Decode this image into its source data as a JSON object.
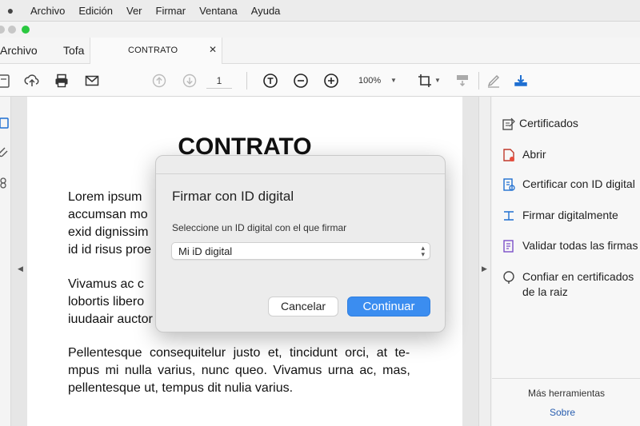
{
  "menubar": {
    "apple_icon": "apple-icon",
    "items": [
      "Archivo",
      "Edición",
      "Ver",
      "Firmar",
      "Ventana",
      "Ayuda"
    ]
  },
  "window": {
    "traffic_colors": [
      "#c7c7c7",
      "#c7c7c7",
      "#2ac840"
    ]
  },
  "tabs": {
    "home": "Archivo",
    "tools": "Tofa",
    "document": "CONTRATO",
    "close_icon": "close-icon"
  },
  "toolbar": {
    "page_number": "1",
    "zoom": "100%",
    "icons": [
      "create-icon",
      "upload-cloud-icon",
      "print-icon",
      "email-icon",
      "page-up-icon",
      "page-down-icon",
      "select-tool-icon",
      "zoom-out-icon",
      "zoom-in-icon",
      "crop-icon",
      "comment-icon",
      "sign-icon",
      "download-icon"
    ]
  },
  "document": {
    "title": "CONTRATO",
    "paragraphs": [
      [
        "Lorem ipsum",
        "accumsan mo",
        "exid dignissim",
        "id id risus proe"
      ],
      [
        "Vivamus ac c",
        "lobortis libero",
        "iuudaair auctor"
      ],
      [
        "Pellentesque consequitelur justo et, tincidunt orci, at te-",
        "mpus mi nulla varius, nunc queo. Vivamus urna ac, mas,",
        "pellentesque ut, tempus dit nulia varius."
      ]
    ]
  },
  "right_panel": {
    "items": [
      {
        "label": "Certificados",
        "icon": "certificate-icon"
      },
      {
        "label": "Abrir",
        "icon": "open-file-icon"
      },
      {
        "label": "Certificar con ID digital",
        "icon": "certify-icon"
      },
      {
        "label": "Firmar digitalmente",
        "icon": "sign-digitally-icon"
      },
      {
        "label": "Validar todas las firmas",
        "icon": "validate-icon"
      },
      {
        "label": "Confiar en certificados",
        "label2": "de la raiz",
        "icon": "trust-icon"
      }
    ],
    "more_tools": "Más herramientas",
    "about": "Sobre"
  },
  "dialog": {
    "title": "Firmar con ID digital",
    "prompt": "Seleccione un ID digital con el que firmar",
    "selected_id": "Mi iD digital",
    "cancel_label": "Cancelar",
    "continue_label": "Continuar",
    "accent": "#3b8df0"
  }
}
